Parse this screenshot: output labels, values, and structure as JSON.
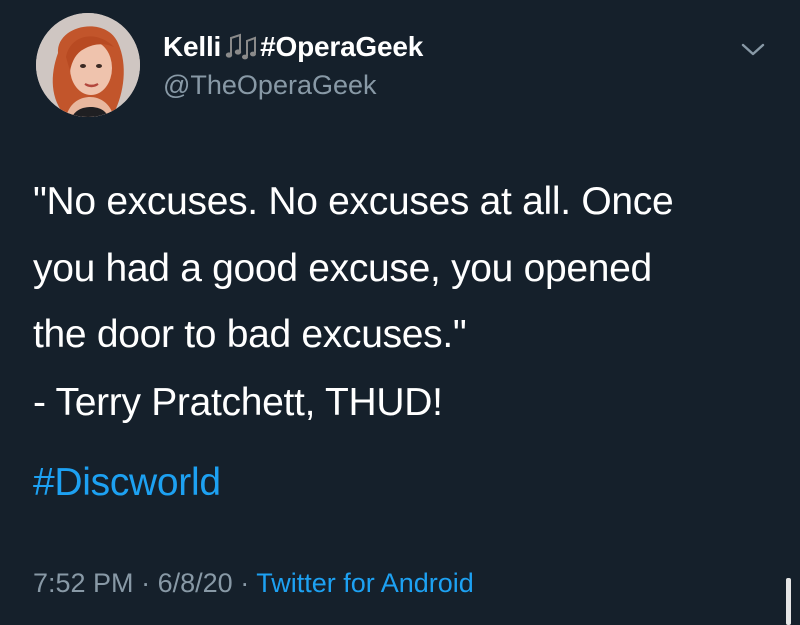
{
  "tweet": {
    "display_name": "Kelli",
    "display_name_emoji": "🎶",
    "display_name_tag": "#OperaGeek",
    "handle": "@TheOperaGeek",
    "text_lines": [
      "\"No excuses. No excuses at all. Once",
      "you had a good excuse, you opened",
      "the door to bad excuses.\"",
      "- Terry Pratchett, THUD!"
    ],
    "hashtag": "#Discworld",
    "time": "7:52 PM",
    "separator": "·",
    "date": "6/8/20",
    "source": "Twitter for Android"
  },
  "icons": {
    "menu": "chevron-down-icon",
    "emoji": "musical-notes-icon"
  },
  "colors": {
    "background": "#15202b",
    "text": "#ffffff",
    "secondary_text": "#8899a6",
    "link": "#1da1f2"
  }
}
